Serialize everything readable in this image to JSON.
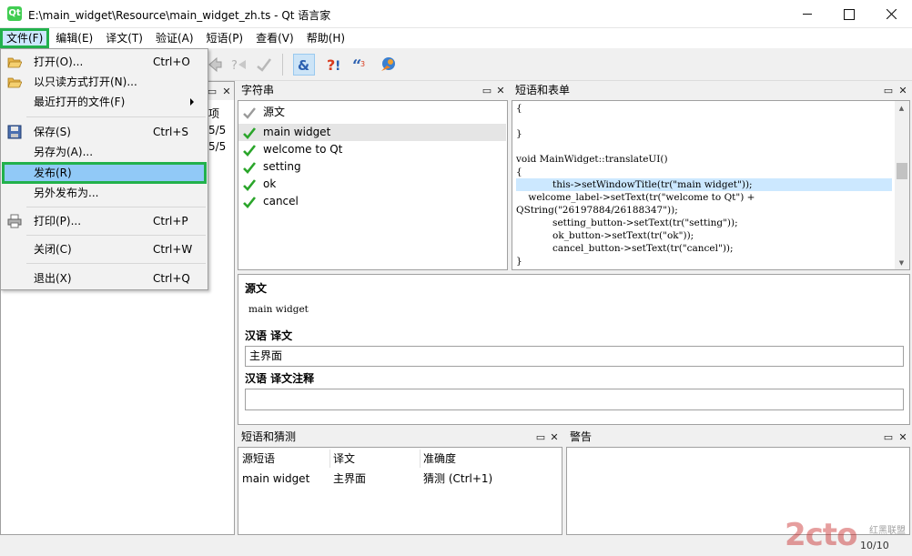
{
  "window": {
    "title": "E:\\main_widget\\Resource\\main_widget_zh.ts - Qt 语言家",
    "app_icon_text": "Qt"
  },
  "menubar": [
    "文件(F)",
    "编辑(E)",
    "译文(T)",
    "验证(A)",
    "短语(P)",
    "查看(V)",
    "帮助(H)"
  ],
  "file_menu": {
    "items": [
      {
        "label": "打开(O)...",
        "shortcut": "Ctrl+O"
      },
      {
        "label": "以只读方式打开(N)...",
        "shortcut": ""
      },
      {
        "label": "最近打开的文件(F)",
        "shortcut": ""
      },
      {
        "label": "保存(S)",
        "shortcut": "Ctrl+S"
      },
      {
        "label": "另存为(A)...",
        "shortcut": ""
      },
      {
        "label": "发布(R)",
        "shortcut": ""
      },
      {
        "label": "另外发布为...",
        "shortcut": ""
      },
      {
        "label": "打印(P)...",
        "shortcut": "Ctrl+P"
      },
      {
        "label": "关闭(C)",
        "shortcut": "Ctrl+W"
      },
      {
        "label": "退出(X)",
        "shortcut": "Ctrl+Q"
      }
    ]
  },
  "context_panel": {
    "header_fragment": "项",
    "rows": [
      "5/5",
      "5/5"
    ]
  },
  "strings_panel": {
    "title": "字符串",
    "header": "源文",
    "items": [
      "main widget",
      "welcome to Qt",
      "setting",
      "ok",
      "cancel"
    ]
  },
  "phrases_forms_panel": {
    "title": "短语和表单",
    "code_lines": [
      "{",
      "",
      "}",
      "",
      "void MainWidget::translateUI()",
      "{",
      "            this->setWindowTitle(tr(\"main widget\"));",
      "    welcome_label->setText(tr(\"welcome to Qt\") +",
      "QString(\"26197884/26188347\"));",
      "            setting_button->setText(tr(\"setting\"));",
      "            ok_button->setText(tr(\"ok\"));",
      "            cancel_button->setText(tr(\"cancel\"));",
      "}"
    ]
  },
  "editor": {
    "source_label": "源文",
    "source_text": "main widget",
    "translation_label": "汉语  译文",
    "translation_value": "主界面",
    "comment_label": "汉语  译文注释",
    "comment_value": ""
  },
  "phrase_guess_panel": {
    "title": "短语和猜测",
    "columns": [
      "源短语",
      "译文",
      "准确度"
    ],
    "rows": [
      [
        "main widget",
        "主界面",
        "猜测 (Ctrl+1)"
      ]
    ]
  },
  "warnings_panel": {
    "title": "警告"
  },
  "status": {
    "count": "10/10"
  },
  "watermark": {
    "text": "2cto",
    "sub": "红黑联盟"
  },
  "colors": {
    "highlight_green": "#22b14c",
    "selection_blue": "#cce8ff",
    "check_green": "#2aa52a"
  }
}
